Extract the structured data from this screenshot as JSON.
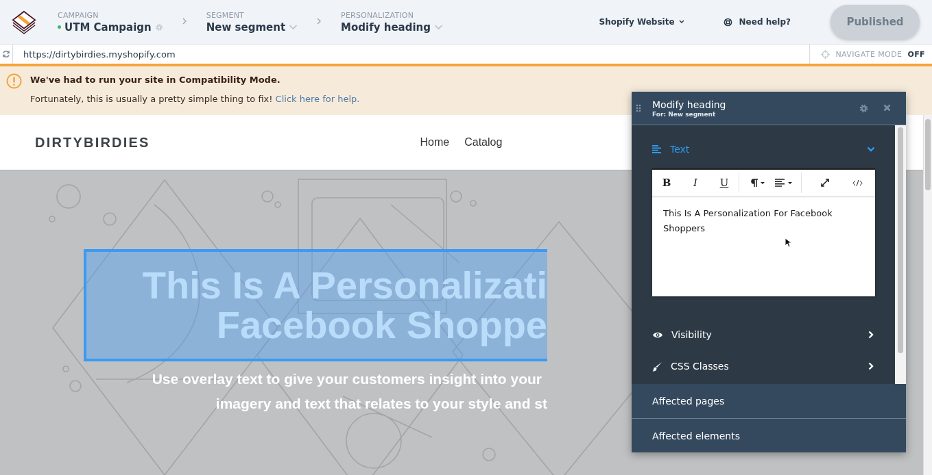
{
  "header": {
    "breadcrumbs": [
      {
        "label": "CAMPAIGN",
        "value": "UTM Campaign",
        "kind": "campaign"
      },
      {
        "label": "SEGMENT",
        "value": "New segment",
        "kind": "dropdown"
      },
      {
        "label": "PERSONALIZATION",
        "value": "Modify heading",
        "kind": "dropdown"
      }
    ],
    "site_menu": "Shopify Website",
    "help": "Need help?",
    "publish_button": "Published"
  },
  "url_bar": {
    "url": "https://dirtybirdies.myshopify.com",
    "navigate_mode": {
      "label": "NAVIGATE MODE",
      "on": false,
      "state_text": "OFF"
    }
  },
  "banner": {
    "title": "We've had to run your site in Compatibility Mode.",
    "message": "Fortunately, this is usually a pretty simple thing to fix!",
    "link": "Click here for help."
  },
  "site": {
    "logo": "DIRTYBIRDIES",
    "nav": [
      "Home",
      "Catalog"
    ],
    "hero": {
      "heading_selected": true,
      "heading_lines": [
        "This Is A Personalizati",
        "Facebook Shoppe"
      ],
      "subtitle_lines": [
        "Use overlay text to give your customers insight into your",
        "imagery and text that relates to your style and st"
      ]
    }
  },
  "panel": {
    "title": "Modify heading",
    "subtitle": "For: New segment",
    "sections": [
      {
        "label": "Text",
        "kind": "text",
        "expanded": true
      },
      {
        "label": "Visibility",
        "kind": "visibility",
        "expanded": false
      },
      {
        "label": "CSS Classes",
        "kind": "css",
        "expanded": false
      }
    ],
    "editor": {
      "toolbar": [
        "B",
        "I",
        "U"
      ],
      "text": "This Is A Personalization For Facebook Shoppers"
    },
    "footer_items": [
      "Affected pages",
      "Affected elements"
    ]
  }
}
